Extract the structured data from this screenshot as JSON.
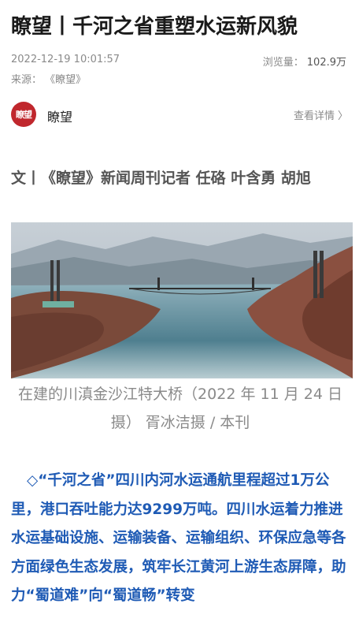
{
  "article": {
    "title": "瞭望丨千河之省重塑水运新风貌",
    "datetime": "2022-12-19 10:01:57",
    "source_label": "来源：",
    "source_name": "《瞭望》",
    "views_label": "浏览量：",
    "views_value": "102.9万"
  },
  "author": {
    "avatar_text": "瞭望",
    "name": "瞭望",
    "detail_link": "查看详情",
    "chevron": "〉"
  },
  "byline": "文丨《瞭望》新闻周刊记者  任硌  叶含勇  胡旭",
  "photo": {
    "caption": "在建的川滇金沙江特大桥（2022 年 11 月 24 日摄） 胥冰洁摄 / 本刊"
  },
  "lead": {
    "marker": "◇",
    "text": "“千河之省”四川内河水运通航里程超过1万公里，港口吞吐能力达9299万吨。四川水运着力推进水运基础设施、运输装备、运输组织、环保应急等各方面绿色生态发展，筑牢长江黄河上游生态屏障，助力“蜀道难”向“蜀道畅”转变"
  },
  "colors": {
    "accent_blue": "#1f5bb5",
    "brand_red": "#c0272d",
    "muted_gray": "#8a8a8a"
  },
  "icons": {
    "chevron": "chevron-right-icon"
  }
}
